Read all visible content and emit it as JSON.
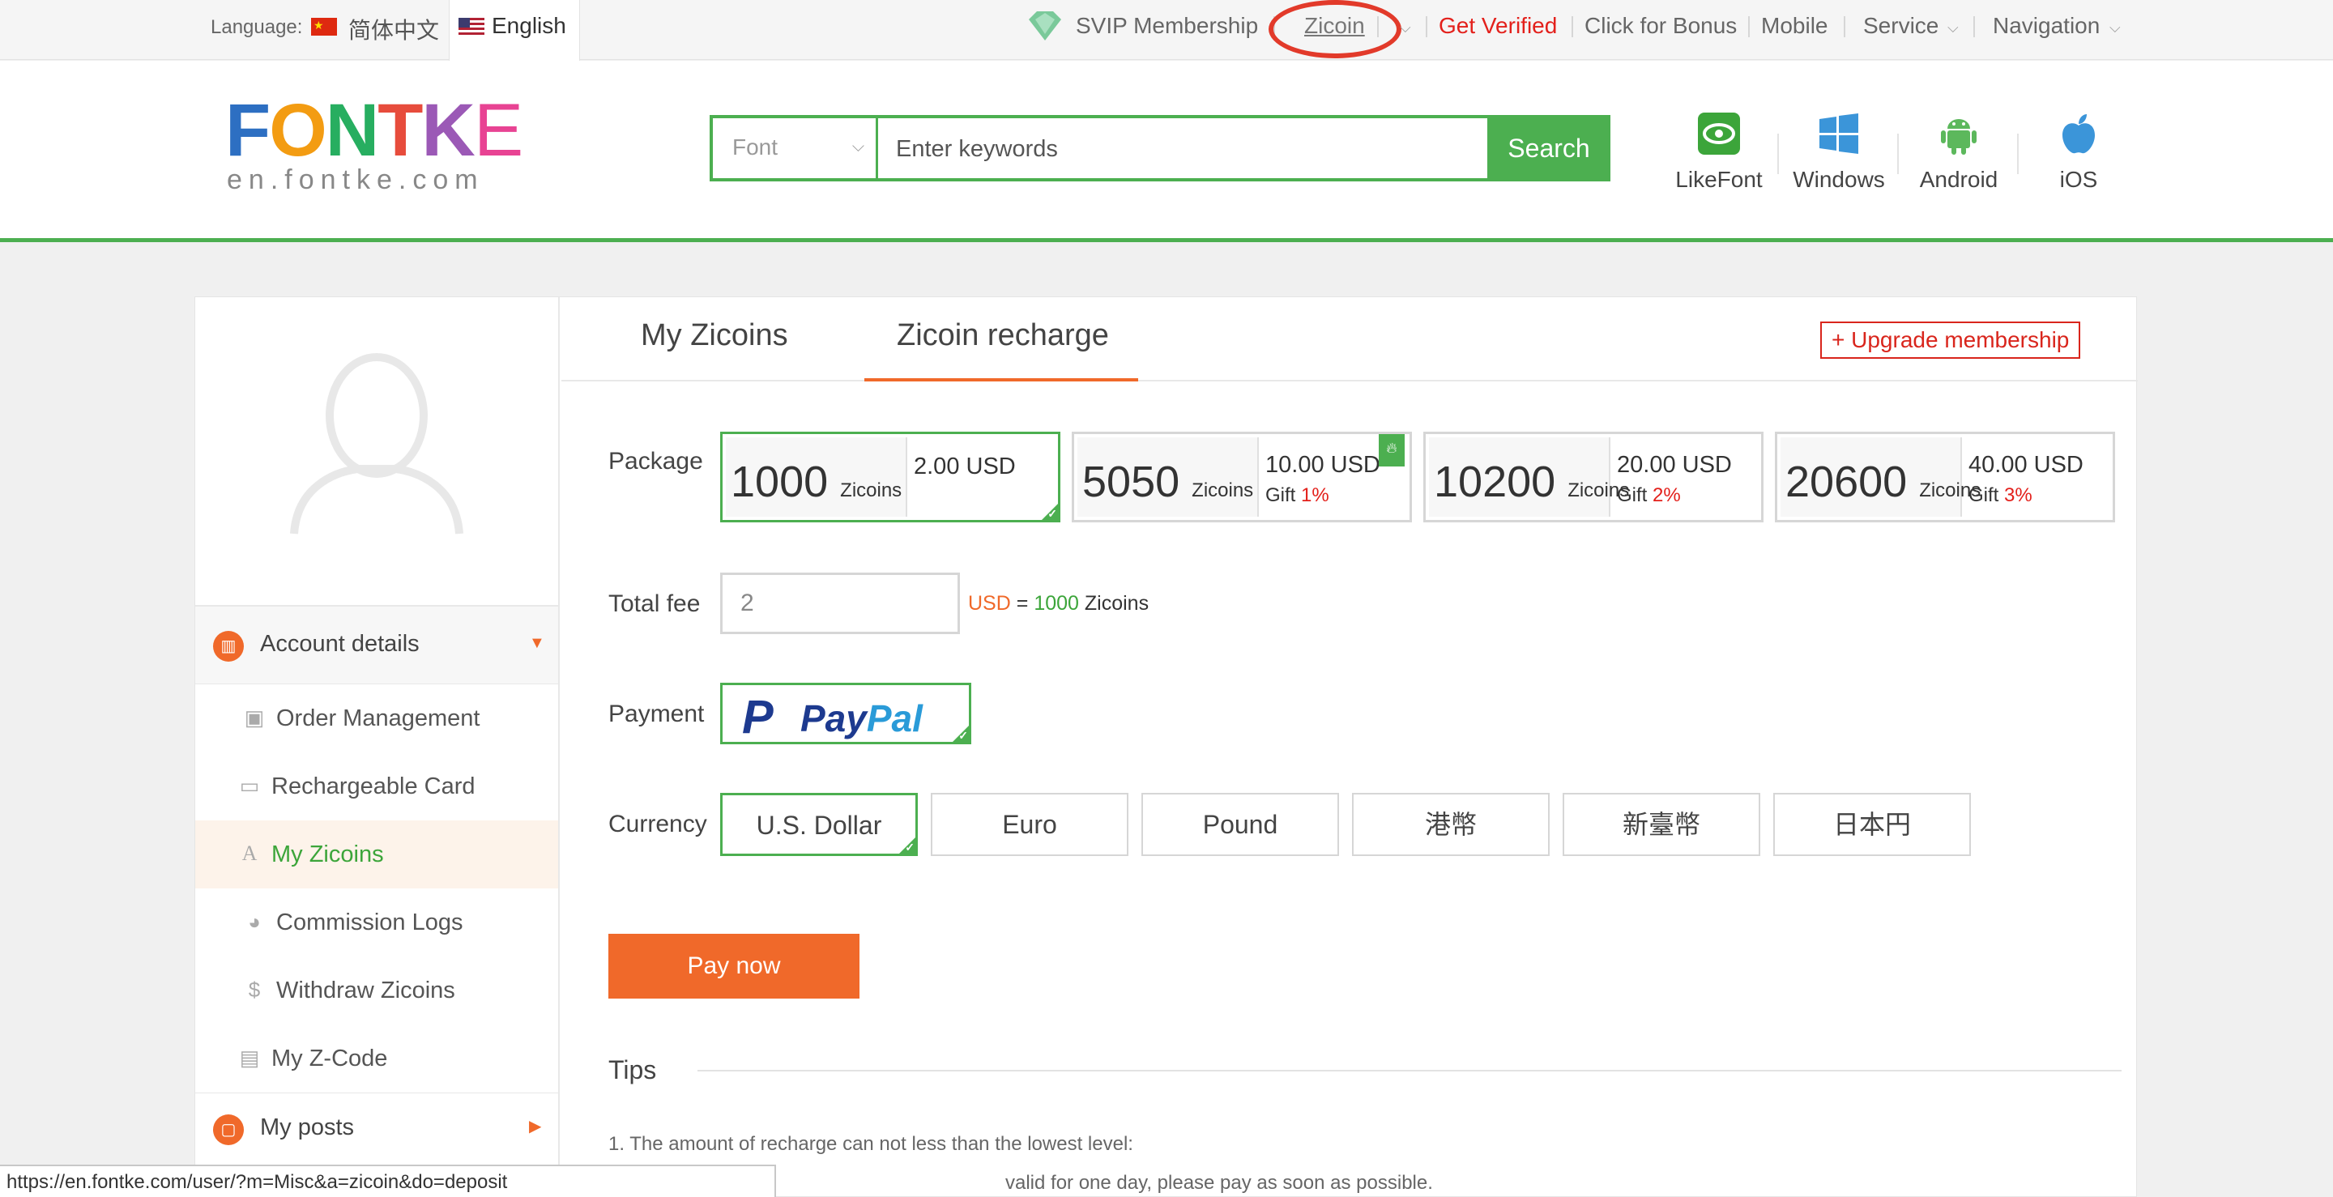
{
  "topbar": {
    "language_label": "Language:",
    "lang_cn": "简体中文",
    "lang_en": "English",
    "svip": "SVIP Membership",
    "zicoin": "Zicoin",
    "get_verified": "Get Verified",
    "bonus": "Click for Bonus",
    "mobile": "Mobile",
    "service": "Service",
    "navigation": "Navigation"
  },
  "header": {
    "logo_sub": "en.fontke.com",
    "search": {
      "category": "Font",
      "placeholder": "Enter keywords",
      "button": "Search"
    },
    "apps": [
      {
        "label": "LikeFont",
        "icon": "likefont-icon"
      },
      {
        "label": "Windows",
        "icon": "windows-icon"
      },
      {
        "label": "Android",
        "icon": "android-icon"
      },
      {
        "label": "iOS",
        "icon": "apple-icon"
      }
    ]
  },
  "sidebar": {
    "groups": [
      {
        "label": "Account details",
        "icon": "chart-icon"
      },
      {
        "label": "My posts",
        "icon": "monitor-icon"
      }
    ],
    "items": [
      {
        "label": "Order Management",
        "icon": "money-icon"
      },
      {
        "label": "Rechargeable Card",
        "icon": "card-icon"
      },
      {
        "label": "My Zicoins",
        "icon": "letter-a-icon",
        "active": true
      },
      {
        "label": "Commission Logs",
        "icon": "pie-icon"
      },
      {
        "label": "Withdraw Zicoins",
        "icon": "strike-s-icon"
      },
      {
        "label": "My Z-Code",
        "icon": "code-icon"
      }
    ]
  },
  "content": {
    "tabs": [
      "My Zicoins",
      "Zicoin recharge"
    ],
    "active_tab": "Zicoin recharge",
    "upgrade": "+ Upgrade membership",
    "labels": {
      "package": "Package",
      "total_fee": "Total fee",
      "payment": "Payment",
      "currency": "Currency"
    },
    "packages": [
      {
        "amount": "1000",
        "unit": "Zicoins",
        "price": "2.00  USD",
        "gift_label": "",
        "gift": "",
        "selected": true,
        "hot": false
      },
      {
        "amount": "5050",
        "unit": "Zicoins",
        "price": "10.00  USD",
        "gift_label": "Gift",
        "gift": "1%",
        "selected": false,
        "hot": true
      },
      {
        "amount": "10200",
        "unit": "Zicoins",
        "price": "20.00  USD",
        "gift_label": "Gift",
        "gift": "2%",
        "selected": false,
        "hot": false
      },
      {
        "amount": "20600",
        "unit": "Zicoins",
        "price": "40.00  USD",
        "gift_label": "Gift",
        "gift": "3%",
        "selected": false,
        "hot": false
      }
    ],
    "total_fee_value": "2",
    "fee_note": {
      "usd": "USD",
      "eq": "=",
      "num": "1000",
      "unit": "Zicoins"
    },
    "payment_method": {
      "pay": "Pay",
      "pal": "Pal"
    },
    "currencies": [
      "U.S. Dollar",
      "Euro",
      "Pound",
      "港幣",
      "新臺幣",
      "日本円"
    ],
    "selected_currency": "U.S. Dollar",
    "pay_button": "Pay now",
    "tips_title": "Tips",
    "tips": [
      "1. The amount of recharge can not less than the lowest level:",
      "valid for one day, please pay as soon as possible."
    ]
  },
  "statusbar": {
    "url": "https://en.fontke.com/user/?m=Misc&a=zicoin&do=deposit"
  },
  "colors": {
    "brand_green": "#4caf50",
    "accent_orange": "#f0692a",
    "alert_red": "#e3201b",
    "annotation_red": "#e23a2a"
  }
}
